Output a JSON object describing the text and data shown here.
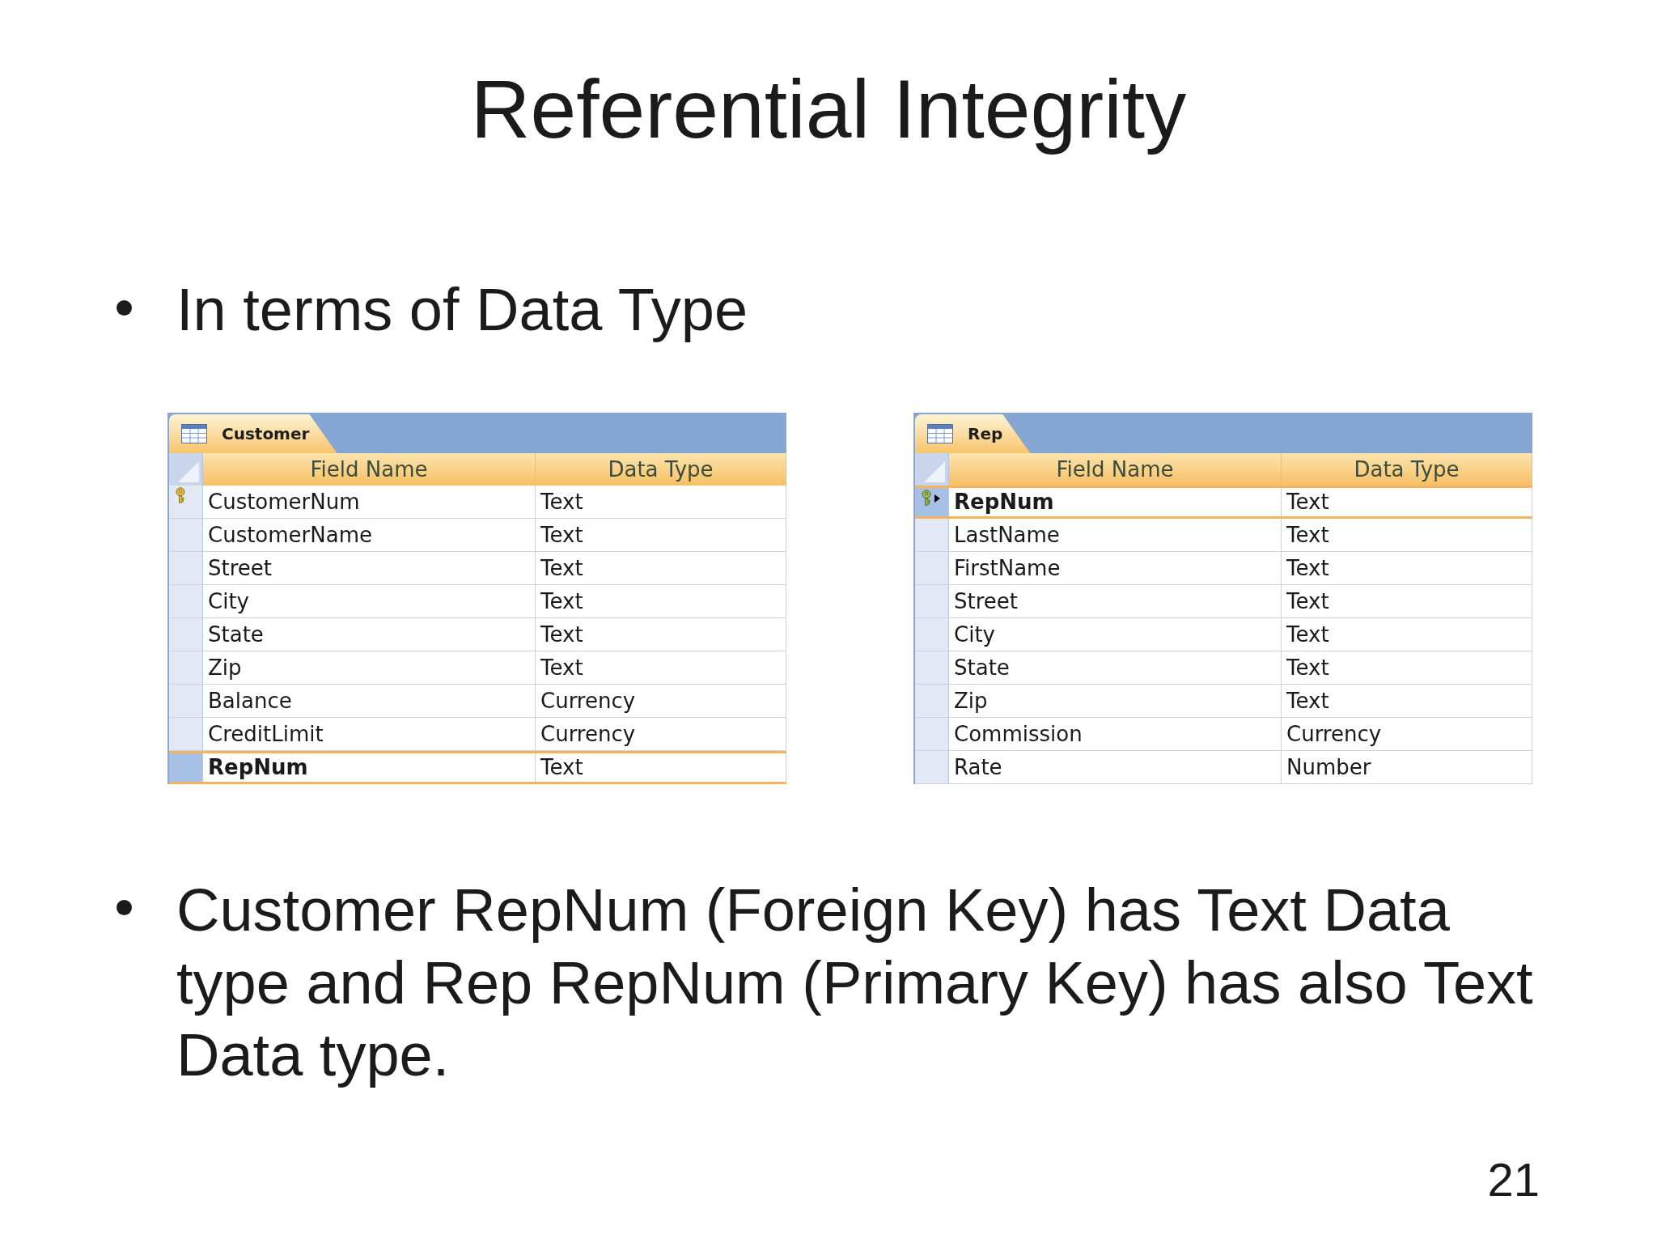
{
  "title": "Referential Integrity",
  "intro_bullet": "In terms of Data Type",
  "tables": [
    {
      "tab": "Customer",
      "columns": [
        "Field Name",
        "Data Type"
      ],
      "rows": [
        {
          "field_name": "CustomerNum",
          "data_type": "Text",
          "primary_key": true,
          "current": false,
          "selected": false
        },
        {
          "field_name": "CustomerName",
          "data_type": "Text",
          "primary_key": false,
          "current": false,
          "selected": false
        },
        {
          "field_name": "Street",
          "data_type": "Text",
          "primary_key": false,
          "current": false,
          "selected": false
        },
        {
          "field_name": "City",
          "data_type": "Text",
          "primary_key": false,
          "current": false,
          "selected": false
        },
        {
          "field_name": "State",
          "data_type": "Text",
          "primary_key": false,
          "current": false,
          "selected": false
        },
        {
          "field_name": "Zip",
          "data_type": "Text",
          "primary_key": false,
          "current": false,
          "selected": false
        },
        {
          "field_name": "Balance",
          "data_type": "Currency",
          "primary_key": false,
          "current": false,
          "selected": false
        },
        {
          "field_name": "CreditLimit",
          "data_type": "Currency",
          "primary_key": false,
          "current": false,
          "selected": false
        },
        {
          "field_name": "RepNum",
          "data_type": "Text",
          "primary_key": false,
          "current": false,
          "selected": true
        }
      ]
    },
    {
      "tab": "Rep",
      "columns": [
        "Field Name",
        "Data Type"
      ],
      "rows": [
        {
          "field_name": "RepNum",
          "data_type": "Text",
          "primary_key": true,
          "current": true,
          "selected": true
        },
        {
          "field_name": "LastName",
          "data_type": "Text",
          "primary_key": false,
          "current": false,
          "selected": false
        },
        {
          "field_name": "FirstName",
          "data_type": "Text",
          "primary_key": false,
          "current": false,
          "selected": false
        },
        {
          "field_name": "Street",
          "data_type": "Text",
          "primary_key": false,
          "current": false,
          "selected": false
        },
        {
          "field_name": "City",
          "data_type": "Text",
          "primary_key": false,
          "current": false,
          "selected": false
        },
        {
          "field_name": "State",
          "data_type": "Text",
          "primary_key": false,
          "current": false,
          "selected": false
        },
        {
          "field_name": "Zip",
          "data_type": "Text",
          "primary_key": false,
          "current": false,
          "selected": false
        },
        {
          "field_name": "Commission",
          "data_type": "Currency",
          "primary_key": false,
          "current": false,
          "selected": false
        },
        {
          "field_name": "Rate",
          "data_type": "Number",
          "primary_key": false,
          "current": false,
          "selected": false
        }
      ]
    }
  ],
  "conclusion_bullet": "Customer RepNum (Foreign Key) has Text Data type and Rep RepNum (Primary Key) has also Text Data type.",
  "page_number": "21"
}
